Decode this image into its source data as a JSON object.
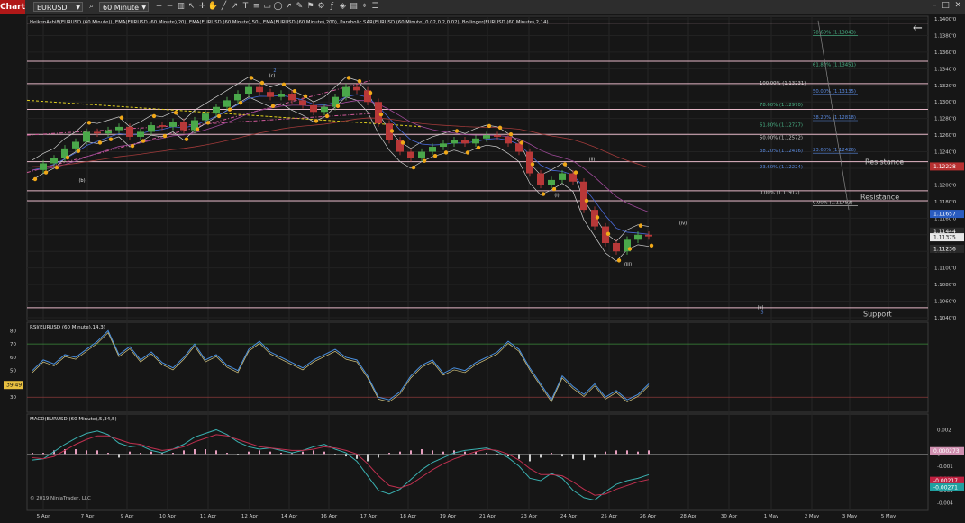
{
  "toolbar": {
    "app_tab": "Chart",
    "instrument": "EURUSD",
    "interval": "60 Minute",
    "icons": [
      "search-icon",
      "zoom-in-icon",
      "zoom-out-icon",
      "bar-style-icon",
      "cursor-icon",
      "crosshair-icon",
      "hand-icon",
      "line-icon",
      "ray-icon",
      "text-icon",
      "fibonacci-icon",
      "rectangle-icon",
      "ellipse-icon",
      "arrow-icon",
      "pencil-icon",
      "label-icon",
      "properties-icon",
      "indicators-icon",
      "strategies-icon",
      "templates-icon",
      "magnet-icon",
      "settings-icon"
    ],
    "window_controls": [
      "minimize-icon",
      "maximize-icon",
      "close-icon"
    ]
  },
  "chart_data": [
    {
      "type": "candlestick",
      "title": "HeikenAshi8(EURUSD (60 Minute)), EMA(EURUSD (60 Minute),20), EMA(EURUSD (60 Minute),50), EMA(EURUSD (60 Minute),200), Parabolic SAR(EURUSD (60 Minute),0.02,0.2,0.02), Bollinger(EURUSD (60 Minute),2,14)",
      "ylim": [
        1.104,
        1.14
      ],
      "y_ticks": [
        "1.1400'0",
        "1.1380'0",
        "1.1360'0",
        "1.1340'0",
        "1.1320'0",
        "1.1300'0",
        "1.1280'0",
        "1.1260'0",
        "1.1240'0",
        "1.1220'0",
        "1.1200'0",
        "1.1180'0",
        "1.1160'0",
        "1.1140'0",
        "1.1120'0",
        "1.1100'0",
        "1.1080'0",
        "1.1060'0",
        "1.1040'0"
      ],
      "price_tags": [
        {
          "value": 1.12228,
          "label": "1.12228",
          "color": "#b83030"
        },
        {
          "value": 1.11657,
          "label": "1.11657",
          "color": "#2a5cc0"
        },
        {
          "value": 1.11444,
          "label": "1.11444",
          "color": "#2a2a2a"
        },
        {
          "value": 1.11375,
          "label": "1.11375",
          "color": "#e8e8e8"
        },
        {
          "value": 1.11236,
          "label": "1.11236",
          "color": "#2a2a2a"
        }
      ],
      "horizontal_levels": [
        1.1395,
        1.1349,
        1.1322,
        1.1291,
        1.1261,
        1.1228,
        1.1193,
        1.1181,
        1.1052
      ],
      "zone_labels": [
        {
          "text": "Resistance",
          "value": 1.1228
        },
        {
          "text": "Resistance",
          "value": 1.1186
        },
        {
          "text": "Support",
          "value": 1.1045
        }
      ],
      "wave_labels": [
        {
          "text": "2",
          "x": "12 Apr",
          "value": 1.1336
        },
        {
          "text": "(c)",
          "x": "12 Apr",
          "value": 1.133
        },
        {
          "text": "(b)",
          "x": "5 Apr",
          "value": 1.1204
        },
        {
          "text": "(i)",
          "x": "23 Apr",
          "value": 1.1186
        },
        {
          "text": "(ii)",
          "x": "24 Apr",
          "value": 1.1229
        },
        {
          "text": "(iii)",
          "x": "25 Apr",
          "value": 1.1103
        },
        {
          "text": "(iv)",
          "x": "27 Apr",
          "value": 1.1152
        },
        {
          "text": "(v)",
          "x": "30 Apr",
          "value": 1.1051
        },
        {
          "text": "3",
          "x": "30 Apr",
          "value": 1.1045
        }
      ],
      "fib_retracement_1": [
        {
          "label": "100.00% (1.13231)",
          "value": 1.13231
        },
        {
          "label": "78.60% (1.12970)",
          "value": 1.1297
        },
        {
          "label": "61.80% (1.12727)",
          "value": 1.12727
        },
        {
          "label": "50.00% (1.12572)",
          "value": 1.12572
        },
        {
          "label": "38.20% (1.12416)",
          "value": 1.12416
        },
        {
          "label": "23.60% (1.12224)",
          "value": 1.12224
        },
        {
          "label": "0.00% (1.11912)",
          "value": 1.11912
        }
      ],
      "fib_retracement_2": [
        {
          "label": "78.60% (1.13843)",
          "value": 1.13843
        },
        {
          "label": "61.80% (1.13451)",
          "value": 1.13451
        },
        {
          "label": "50.00% (1.13135)",
          "value": 1.13135
        },
        {
          "label": "38.20% (1.12818)",
          "value": 1.12818
        },
        {
          "label": "23.60% (1.12426)",
          "value": 1.12426
        },
        {
          "label": "0.00% (1.11793)",
          "value": 1.11793
        }
      ],
      "close_series": [
        1.1218,
        1.1226,
        1.1232,
        1.1244,
        1.1252,
        1.1264,
        1.1262,
        1.1266,
        1.127,
        1.1258,
        1.1264,
        1.1272,
        1.127,
        1.1276,
        1.1266,
        1.1278,
        1.1286,
        1.1294,
        1.1302,
        1.131,
        1.1318,
        1.1312,
        1.1306,
        1.131,
        1.1302,
        1.1296,
        1.1288,
        1.1294,
        1.1306,
        1.1318,
        1.1314,
        1.13,
        1.1274,
        1.1254,
        1.124,
        1.1232,
        1.124,
        1.1246,
        1.125,
        1.1254,
        1.125,
        1.1256,
        1.126,
        1.1258,
        1.125,
        1.124,
        1.1214,
        1.12,
        1.1206,
        1.1214,
        1.1204,
        1.117,
        1.115,
        1.113,
        1.112,
        1.1134,
        1.114,
        1.1138
      ],
      "projection_path": {
        "x": [
          "26 Apr",
          "27 Apr",
          "30 Apr"
        ],
        "values": [
          1.114,
          1.1152,
          1.1052
        ]
      }
    },
    {
      "type": "line",
      "title": "RSI(EURUSD (60 Minute),14,3)",
      "ylim": [
        20,
        85
      ],
      "y_ticks": [
        "80",
        "70",
        "60",
        "50",
        "40",
        "30"
      ],
      "levels": [
        70,
        30
      ],
      "current_value": "39.49",
      "values": [
        50,
        58,
        55,
        62,
        60,
        66,
        72,
        80,
        62,
        68,
        58,
        64,
        56,
        52,
        60,
        70,
        58,
        62,
        54,
        50,
        66,
        72,
        64,
        60,
        56,
        52,
        58,
        62,
        66,
        60,
        58,
        46,
        30,
        28,
        34,
        46,
        54,
        58,
        48,
        52,
        50,
        56,
        60,
        64,
        72,
        66,
        52,
        40,
        28,
        46,
        38,
        32,
        40,
        30,
        35,
        28,
        32,
        40
      ]
    },
    {
      "type": "bar",
      "title": "MACD(EURUSD (60 Minute),5,34,5)",
      "ylim": [
        -0.0045,
        0.003
      ],
      "y_ticks": [
        "0.002",
        "0",
        "-0.001",
        "-0.002",
        "-0.003",
        "-0.004"
      ],
      "value_tags": [
        {
          "label": "0.000273",
          "value": 0.000273
        },
        {
          "label": "-0.00217",
          "value": -0.00217
        },
        {
          "label": "-0.00271",
          "value": -0.00271
        }
      ],
      "macd": [
        -0.0005,
        -0.0004,
        0.0002,
        0.0008,
        0.0013,
        0.0017,
        0.0019,
        0.0016,
        0.0009,
        0.0006,
        0.0007,
        0.0003,
        0.0001,
        0.0004,
        0.0008,
        0.0014,
        0.0017,
        0.002,
        0.0016,
        0.001,
        0.0006,
        0.0004,
        0.0005,
        0.0003,
        0.0001,
        0.0003,
        0.0006,
        0.0008,
        0.0004,
        0.0001,
        -0.0006,
        -0.0018,
        -0.003,
        -0.0033,
        -0.0029,
        -0.0021,
        -0.0013,
        -0.0007,
        -0.0003,
        0.0001,
        0.0003,
        0.0004,
        0.0005,
        0.0002,
        -0.0003,
        -0.001,
        -0.002,
        -0.0022,
        -0.0016,
        -0.002,
        -0.003,
        -0.0036,
        -0.0038,
        -0.0031,
        -0.0025,
        -0.0022,
        -0.002,
        -0.0017
      ],
      "signal": [
        -0.0003,
        -0.0004,
        -0.0002,
        0.0003,
        0.0008,
        0.0012,
        0.0015,
        0.0015,
        0.0012,
        0.0009,
        0.0008,
        0.0005,
        0.0003,
        0.0004,
        0.0006,
        0.001,
        0.0013,
        0.0016,
        0.0015,
        0.0012,
        0.0009,
        0.0006,
        0.0005,
        0.0004,
        0.0003,
        0.0003,
        0.0004,
        0.0006,
        0.0005,
        0.0003,
        0.0,
        -0.0008,
        -0.0018,
        -0.0026,
        -0.0028,
        -0.0025,
        -0.0019,
        -0.0013,
        -0.0008,
        -0.0004,
        -0.0001,
        0.0002,
        0.0004,
        0.0003,
        0.0,
        -0.0005,
        -0.0012,
        -0.0017,
        -0.0017,
        -0.0018,
        -0.0023,
        -0.0029,
        -0.0034,
        -0.0033,
        -0.0029,
        -0.0026,
        -0.0023,
        -0.0021
      ],
      "histogram": [
        0.0001,
        0.0001,
        0.0003,
        0.0004,
        0.0004,
        0.0003,
        0.0003,
        0.0001,
        -0.0003,
        0.0002,
        0.0001,
        0.0002,
        0.0001,
        0.0001,
        0.0003,
        0.0004,
        0.0004,
        0.0003,
        0.0001,
        -0.0001,
        0.0002,
        0.0003,
        0.0002,
        0.0001,
        0.0001,
        0.0002,
        0.0003,
        0.0002,
        -0.0001,
        -0.0002,
        -0.0004,
        -0.0006,
        -0.0003,
        0.0001,
        0.0002,
        0.0003,
        0.0004,
        0.0003,
        0.0002,
        0.0003,
        0.0002,
        0.0002,
        0.0001,
        -0.0001,
        -0.0002,
        -0.0004,
        -0.0006,
        -0.0003,
        0.0001,
        -0.0002,
        -0.0004,
        -0.0005,
        -0.0003,
        0.0002,
        0.0003,
        0.0003,
        0.0002,
        0.0003
      ]
    }
  ],
  "x_axis": {
    "labels": [
      "5 Apr",
      "7 Apr",
      "9 Apr",
      "10 Apr",
      "11 Apr",
      "12 Apr",
      "14 Apr",
      "16 Apr",
      "17 Apr",
      "18 Apr",
      "19 Apr",
      "21 Apr",
      "23 Apr",
      "24 Apr",
      "25 Apr",
      "26 Apr",
      "28 Apr",
      "30 Apr",
      "1 May",
      "2 May",
      "3 May",
      "5 May"
    ]
  },
  "copyright": "© 2019 NinjaTrader, LLC"
}
